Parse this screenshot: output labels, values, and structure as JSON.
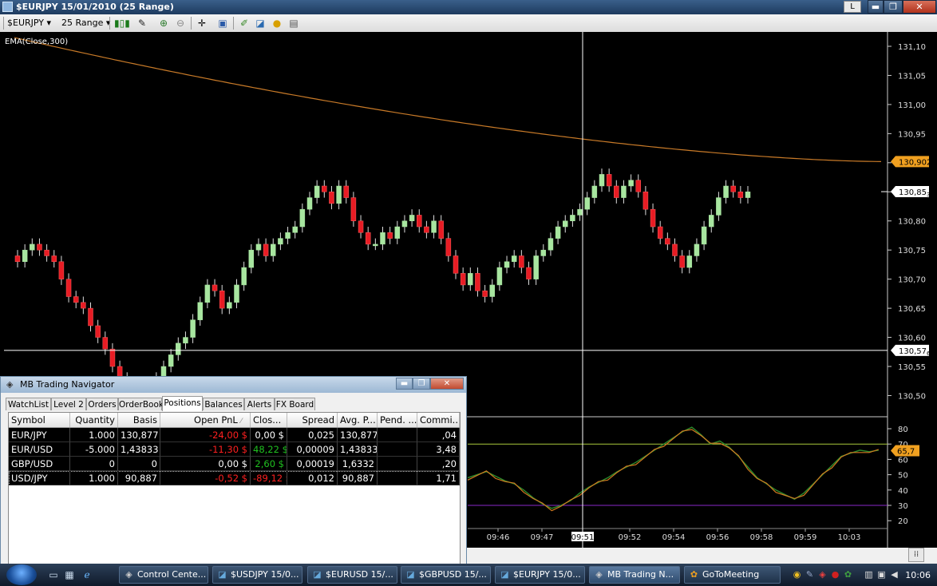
{
  "window": {
    "title": "$EURJPY  15/01/2010 (25 Range)",
    "l_button": "L",
    "min_symbol": "▬",
    "max_symbol": "❐",
    "close_symbol": "✕"
  },
  "toolbar": {
    "symbol": "$EURJPY",
    "interval": "25 Range",
    "dropdown_arrow": "▾"
  },
  "chart": {
    "indicator_label": "EMA(Close,300)",
    "price_ticks": [
      "131,10",
      "131,05",
      "131,00",
      "130,95",
      "130,90",
      "130,85",
      "130,80",
      "130,75",
      "130,70",
      "130,65",
      "130,60",
      "130,55",
      "130,50"
    ],
    "ema_value_label": "130,902",
    "last_price_label": "130,85",
    "last_price_sub": "3",
    "cursor_price_label": "130,57",
    "cursor_price_sub": "6",
    "osc_ticks": [
      "80",
      "70",
      "60",
      "50",
      "40",
      "30",
      "20"
    ],
    "osc_value_label": "65,7",
    "time_ticks": [
      "09:46",
      "09:47",
      "09:51",
      "09:52",
      "09:54",
      "09:56",
      "09:58",
      "09:59",
      "10:03"
    ],
    "cursor_time_label": "09:51",
    "colors": {
      "up": "#a8e6a0",
      "down": "#e81c24",
      "ema": "#c87a28",
      "osc_fast": "#2c8a2c",
      "osc_slow": "#d27a20",
      "level_high": "#a8c83a",
      "level_low": "#8a28c8"
    }
  },
  "chart_data": {
    "type": "candlestick",
    "title": "$EURJPY  15/01/2010 (25 Range)",
    "ylim": [
      130.46,
      131.13
    ],
    "indicator": "EMA(Close,300)",
    "ema_last": 130.902,
    "last_price": 130.8503,
    "crosshair_price": 130.5776,
    "closes": [
      130.73,
      130.75,
      130.76,
      130.75,
      130.74,
      130.73,
      130.7,
      130.67,
      130.66,
      130.65,
      130.62,
      130.6,
      130.58,
      130.55,
      130.53,
      130.51,
      130.47,
      130.49,
      130.51,
      130.53,
      130.55,
      130.57,
      130.59,
      130.6,
      130.63,
      130.66,
      130.69,
      130.68,
      130.65,
      130.66,
      130.69,
      130.72,
      130.75,
      130.76,
      130.74,
      130.76,
      130.77,
      130.78,
      130.79,
      130.82,
      130.84,
      130.86,
      130.85,
      130.83,
      130.86,
      130.84,
      130.8,
      130.78,
      130.76,
      130.76,
      130.78,
      130.77,
      130.79,
      130.8,
      130.81,
      130.79,
      130.78,
      130.8,
      130.77,
      130.74,
      130.71,
      130.69,
      130.71,
      130.68,
      130.67,
      130.69,
      130.72,
      130.73,
      130.74,
      130.72,
      130.7,
      130.74,
      130.75,
      130.77,
      130.79,
      130.8,
      130.81,
      130.82,
      130.84,
      130.86,
      130.88,
      130.86,
      130.84,
      130.86,
      130.87,
      130.85,
      130.82,
      130.79,
      130.77,
      130.76,
      130.74,
      130.72,
      130.74,
      130.76,
      130.79,
      130.81,
      130.84,
      130.86,
      130.85,
      130.84,
      130.85
    ],
    "oscillator": {
      "levels": [
        70,
        30
      ],
      "last": 65.7
    }
  },
  "navigator": {
    "title": "MB Trading Navigator",
    "tabs": [
      "WatchList",
      "Level 2",
      "Orders",
      "OrderBook",
      "Positions",
      "Balances",
      "Alerts",
      "FX Board"
    ],
    "columns": [
      "Symbol",
      "Quantity",
      "Basis",
      "Open PnL",
      "Clos...",
      "Spread",
      "Avg. P...",
      "Pend. ...",
      "Commi..."
    ],
    "sort_mark": "⁄",
    "rows": [
      {
        "symbol": "EUR/JPY",
        "quantity": "1.000",
        "basis": "130,877",
        "open_pnl": "-24,00 $",
        "close": "0,00 $",
        "spread": "0,025",
        "avg": "130,877",
        "pend": "",
        "comm": ",04"
      },
      {
        "symbol": "EUR/USD",
        "quantity": "-5.000",
        "basis": "1,43833",
        "open_pnl": "-11,30 $",
        "close": "48,22 $",
        "spread": "0,00009",
        "avg": "1,43833",
        "pend": "",
        "comm": "3,48"
      },
      {
        "symbol": "GBP/USD",
        "quantity": "0",
        "basis": "0",
        "open_pnl": "0,00 $",
        "close": "2,60 $",
        "spread": "0,00019",
        "avg": "1,6332",
        "pend": "",
        "comm": ",20"
      },
      {
        "symbol": "USD/JPY",
        "quantity": "1.000",
        "basis": "90,887",
        "open_pnl": "-0,52 $",
        "close": "-89,12 $",
        "spread": "0,012",
        "avg": "90,887",
        "pend": "",
        "comm": "1,71"
      }
    ]
  },
  "taskbar": {
    "buttons": [
      "Control Cente...",
      "$USDJPY 15/0...",
      "$EURUSD 15/...",
      "$GBPUSD 15/...",
      "$EURJPY 15/0...",
      "MB Trading N...",
      "GoToMeeting"
    ],
    "clock": "10:06"
  },
  "hscroll_symbol": "⁞⁞"
}
